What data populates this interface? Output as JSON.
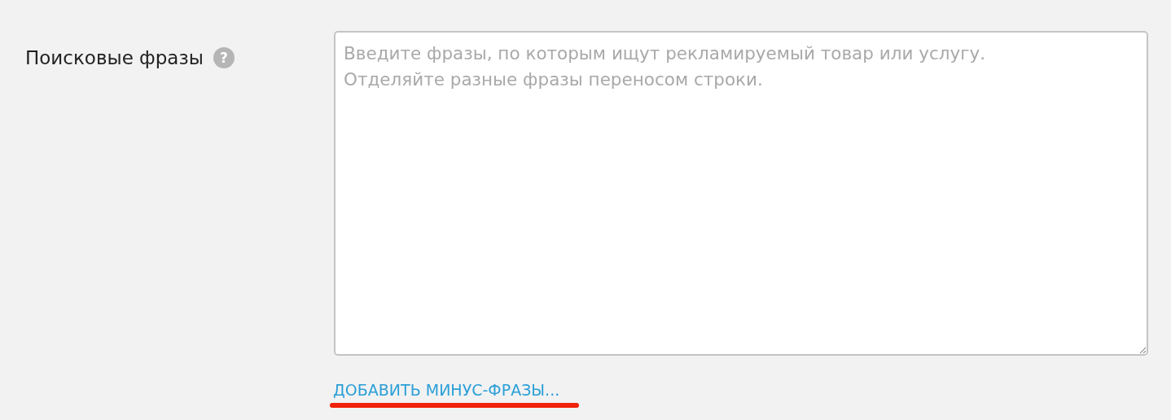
{
  "field": {
    "label": "Поисковые фразы",
    "help_icon": "?",
    "placeholder": "Введите фразы, по которым ищут рекламируемый товар или услугу.\nОтделяйте разные фразы переносом строки."
  },
  "link": {
    "label": "ДОБАВИТЬ МИНУС-ФРАЗЫ..."
  }
}
